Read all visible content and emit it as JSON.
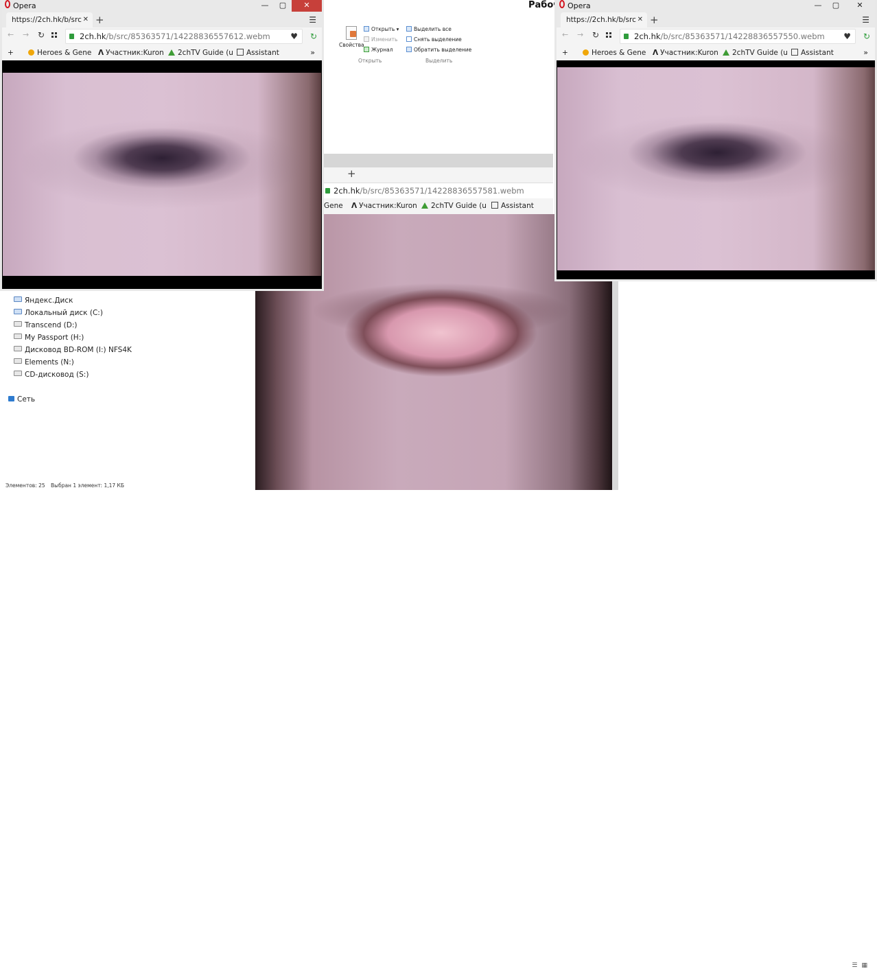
{
  "explorer": {
    "title_partial": "Рабоч",
    "ribbon": {
      "properties_label": "Свойства",
      "open_items": [
        "Открыть ▾",
        "Изменить",
        "Журнал"
      ],
      "open_group": "Открыть",
      "select_items": [
        "Выделить все",
        "Снять выделение",
        "Обратить выделение"
      ],
      "select_group": "Выделить"
    },
    "nav_items": [
      {
        "label": "Яндекс.Диск",
        "icon": "yandex-disk-icon"
      },
      {
        "label": "Локальный диск (C:)",
        "icon": "drive-icon"
      },
      {
        "label": "Transcend (D:)",
        "icon": "drive-icon"
      },
      {
        "label": "My Passport (H:)",
        "icon": "drive-icon"
      },
      {
        "label": "Дисковод BD-ROM (I:) NFS4K",
        "icon": "disc-icon"
      },
      {
        "label": "Elements (N:)",
        "icon": "drive-icon"
      },
      {
        "label": "CD-дисковод (S:)",
        "icon": "disc-icon"
      }
    ],
    "network_label": "Сеть",
    "status": {
      "items": "Элементов: 25",
      "selected": "Выбран 1 элемент: 1,17 КБ"
    }
  },
  "bookmarks": [
    {
      "label": "Heroes & Gene",
      "icon": "heroes-icon"
    },
    {
      "label": "Участник:Kuron",
      "icon": "lambda-icon"
    },
    {
      "label": "2chTV Guide (u",
      "icon": "google-drive-icon"
    },
    {
      "label": "Assistant",
      "icon": "assistant-icon"
    }
  ],
  "windows": {
    "left": {
      "app_label": "Opera",
      "tab_title": "https://2ch.hk/b/src",
      "url_host": "2ch.hk",
      "url_path": "/b/src/85363571/14228836557612.webm"
    },
    "middle": {
      "url_host": "2ch.hk",
      "url_path": "/b/src/85363571/14228836557581.webm",
      "bookmark_first_partial": "Gene"
    },
    "right": {
      "app_label": "Opera",
      "tab_title": "https://2ch.hk/b/src",
      "url_host": "2ch.hk",
      "url_path": "/b/src/85363571/14228836557550.webm"
    }
  },
  "colors": {
    "opera_red": "#d3141f",
    "close_red": "#c7403a",
    "secure_green": "#2f9c3c"
  }
}
